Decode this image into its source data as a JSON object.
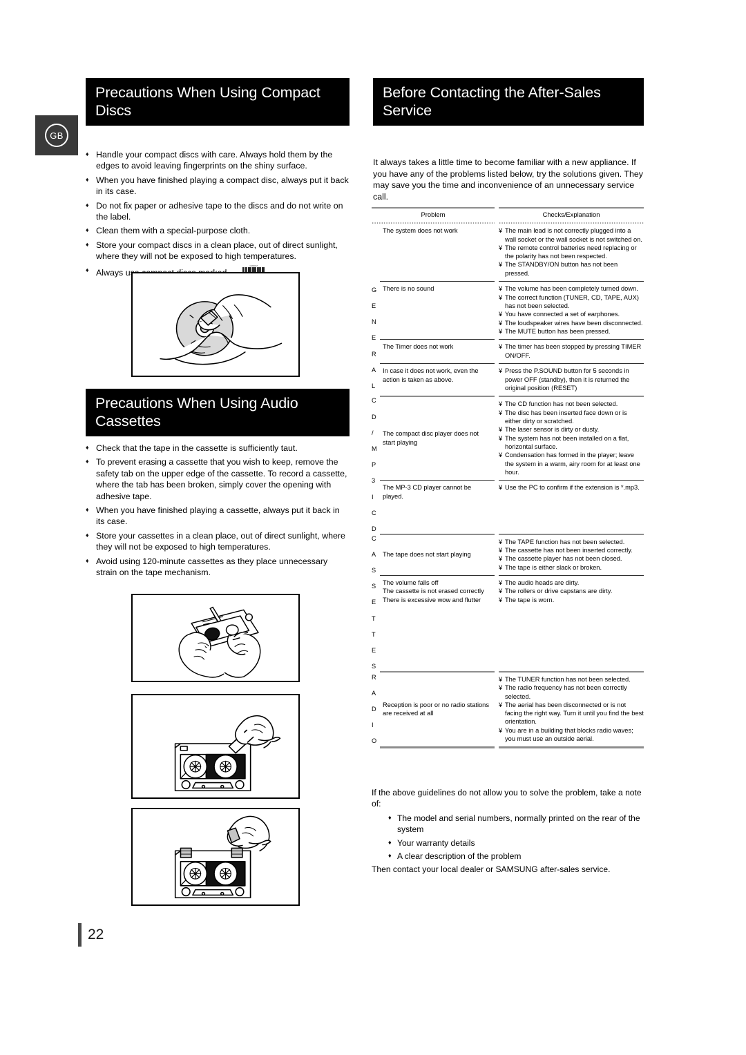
{
  "badge": {
    "label": "GB"
  },
  "page": {
    "number": "22"
  },
  "left_column": {
    "section_cd": {
      "title_line1": "Precautions When Using Compact",
      "title_line2": "Discs",
      "bullets": [
        "Handle your compact discs with care. Always hold them by the edges to avoid leaving fingerprints on the shiny surface.",
        "When you have finished playing a compact disc, always put it back in its case.",
        "Do not fix paper or adhesive tape to the discs and do not write on the label.",
        "Clean them with a special-purpose cloth.",
        "Store your compact discs in a clean place, out of direct sunlight, where they will not be exposed to high temperatures.",
        "Always use compact discs marked"
      ],
      "logo_top": "COMPACT",
      "logo_bottom": "DIGITAL AUDIO",
      "illustration": "hands-holding-compact-disc"
    },
    "section_cassette": {
      "title_line1": "Precautions When Using Audio",
      "title_line2": "Cassettes",
      "bullets": [
        "Check that the tape in the cassette is sufficiently taut.",
        "To prevent erasing a cassette that you wish to keep, remove the safety tab on the upper edge of the cassette. To record a cassette, where  the tab has been broken, simply cover the opening with adhesive tape.",
        "When you have finished playing a cassette, always put it back in its case.",
        "Store your cassettes in a clean place, out of direct sunlight, where they will not be exposed to high temperatures.",
        "Avoid using 120-minute cassettes as they place unnecessary strain on the tape mechanism."
      ],
      "illustrations": [
        "hands-tightening-cassette-tape",
        "hand-breaking-cassette-safety-tab",
        "hand-applying-adhesive-tape-to-cassette"
      ]
    }
  },
  "right_column": {
    "section_service": {
      "title_line1": "Before Contacting the After-Sales",
      "title_line2": "Service",
      "intro": "It always takes a little time to become familiar with a new appliance. If you have any of the problems listed below, try the solutions given. They may save you the time and inconvenience of an unnecessary service call."
    },
    "table": {
      "headers": {
        "problem": "Problem",
        "checks": "Checks/Explanation"
      },
      "groups": [
        {
          "tag": "",
          "tag_letters": [],
          "rows": [
            {
              "problem": [
                "The system does not work"
              ],
              "checks": [
                "The main lead is not correctly plugged into a wall socket or the wall socket is not switched on.",
                "The remote control batteries need replacing or the polarity has not been respected.",
                "The STANDBY/ON button has not been pressed."
              ]
            }
          ]
        },
        {
          "tag": "GENERAL",
          "tag_letters": [
            "G",
            "E",
            "N",
            "E",
            "R",
            "A",
            "L"
          ],
          "rows": [
            {
              "problem": [
                "There is no sound"
              ],
              "checks": [
                "The volume has been completely turned down.",
                "The correct function (TUNER, CD, TAPE, AUX) has not been selected.",
                "You have connected a set of earphones.",
                "The loudspeaker wires have been disconnected.",
                "The MUTE button has been pressed."
              ]
            },
            {
              "problem": [
                "The Timer does not work"
              ],
              "checks": [
                "The timer has been stopped by pressing TIMER ON/OFF."
              ]
            },
            {
              "problem": [
                "In case it does not work, even the action is taken as above."
              ],
              "checks": [
                "Press the P.SOUND button for 5 seconds in power  OFF (standby), then it is returned the original position (RESET)"
              ]
            }
          ]
        },
        {
          "tag": "CD/MP3-CD",
          "tag_letters": [
            "C",
            "D",
            "/",
            "M",
            "P",
            "3",
            "I",
            "C",
            "D"
          ],
          "rows": [
            {
              "problem": [
                "The compact disc player does not start playing"
              ],
              "checks": [
                "The CD function has not been selected.",
                "The disc has been inserted face down or is either dirty or scratched.",
                "The laser sensor is dirty or dusty.",
                "The system has not been installed on a flat, horizontal surface.",
                "Condensation has formed in the player; leave the system in a warm, airy room for at least one hour."
              ]
            },
            {
              "problem": [
                "The MP-3 CD player cannot be played."
              ],
              "checks": [
                "Use the PC to confirm if the extension is *.mp3."
              ]
            }
          ]
        },
        {
          "tag": "CASSETTES",
          "tag_letters": [
            "C",
            "A",
            "S",
            "S",
            "E",
            "T",
            "T",
            "E",
            "S"
          ],
          "rows": [
            {
              "problem": [
                "The tape does not start playing"
              ],
              "checks": [
                "The TAPE function has not been selected.",
                "The cassette has not been inserted correctly.",
                "The cassette player has not been closed.",
                "The tape is either slack or broken."
              ]
            },
            {
              "problem": [
                "The volume falls off",
                "The cassette is not erased correctly",
                "There is excessive wow and flutter"
              ],
              "checks": [
                "The audio heads are dirty.",
                "The rollers or drive capstans are dirty.",
                "The tape is worn."
              ]
            }
          ]
        },
        {
          "tag": "RADIO",
          "tag_letters": [
            "R",
            "A",
            "D",
            "I",
            "O"
          ],
          "rows": [
            {
              "problem": [
                "Reception is poor or no radio stations are received at all"
              ],
              "checks": [
                "The TUNER function has not been selected.",
                "The radio frequency has not been correctly selected.",
                "The aerial has been disconnected or is not facing the right way. Turn it until you find the best orientation.",
                "You are in a building that blocks radio waves; you must use an outside aerial."
              ]
            }
          ]
        }
      ]
    },
    "closing": {
      "intro": "If the above guidelines do not allow you to solve the problem, take a note of:",
      "items": [
        "The model and serial numbers, normally printed on the rear of the system",
        "Your warranty details",
        "A clear description of the problem"
      ],
      "outro": "Then contact your local dealer or SAMSUNG after-sales service."
    }
  }
}
